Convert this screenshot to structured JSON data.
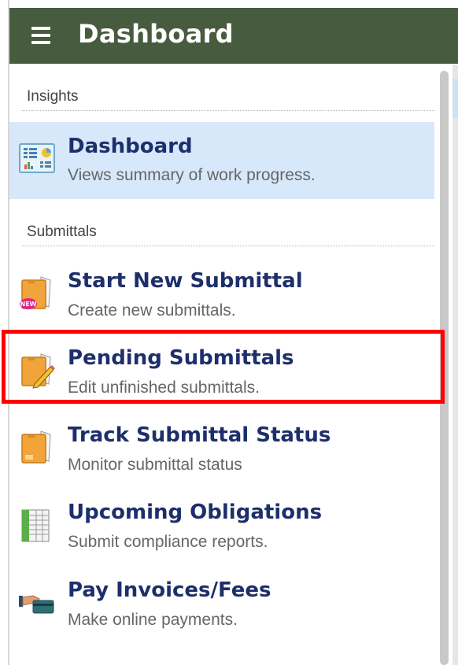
{
  "header": {
    "title": "Dashboard"
  },
  "sections": [
    {
      "label": "Insights",
      "items": [
        {
          "title": "Dashboard",
          "description": "Views summary of work progress.",
          "icon": "dashboard-chart-icon",
          "active": true
        }
      ]
    },
    {
      "label": "Submittals",
      "items": [
        {
          "title": "Start New Submittal",
          "description": "Create new submittals.",
          "icon": "new-folder-icon"
        },
        {
          "title": "Pending Submittals",
          "description": "Edit unfinished submittals.",
          "icon": "edit-folder-icon",
          "highlighted": true
        },
        {
          "title": "Track Submittal Status",
          "description": "Monitor submittal status",
          "icon": "folder-icon"
        },
        {
          "title": "Upcoming Obligations",
          "description": "Submit compliance reports.",
          "icon": "spreadsheet-icon"
        },
        {
          "title": "Pay Invoices/Fees",
          "description": "Make online payments.",
          "icon": "payment-card-icon"
        }
      ]
    }
  ],
  "colors": {
    "header_bg": "#475c3e",
    "title_text": "#1d2f6b",
    "active_bg": "#d7e8fb",
    "highlight_border": "#ff0000"
  }
}
